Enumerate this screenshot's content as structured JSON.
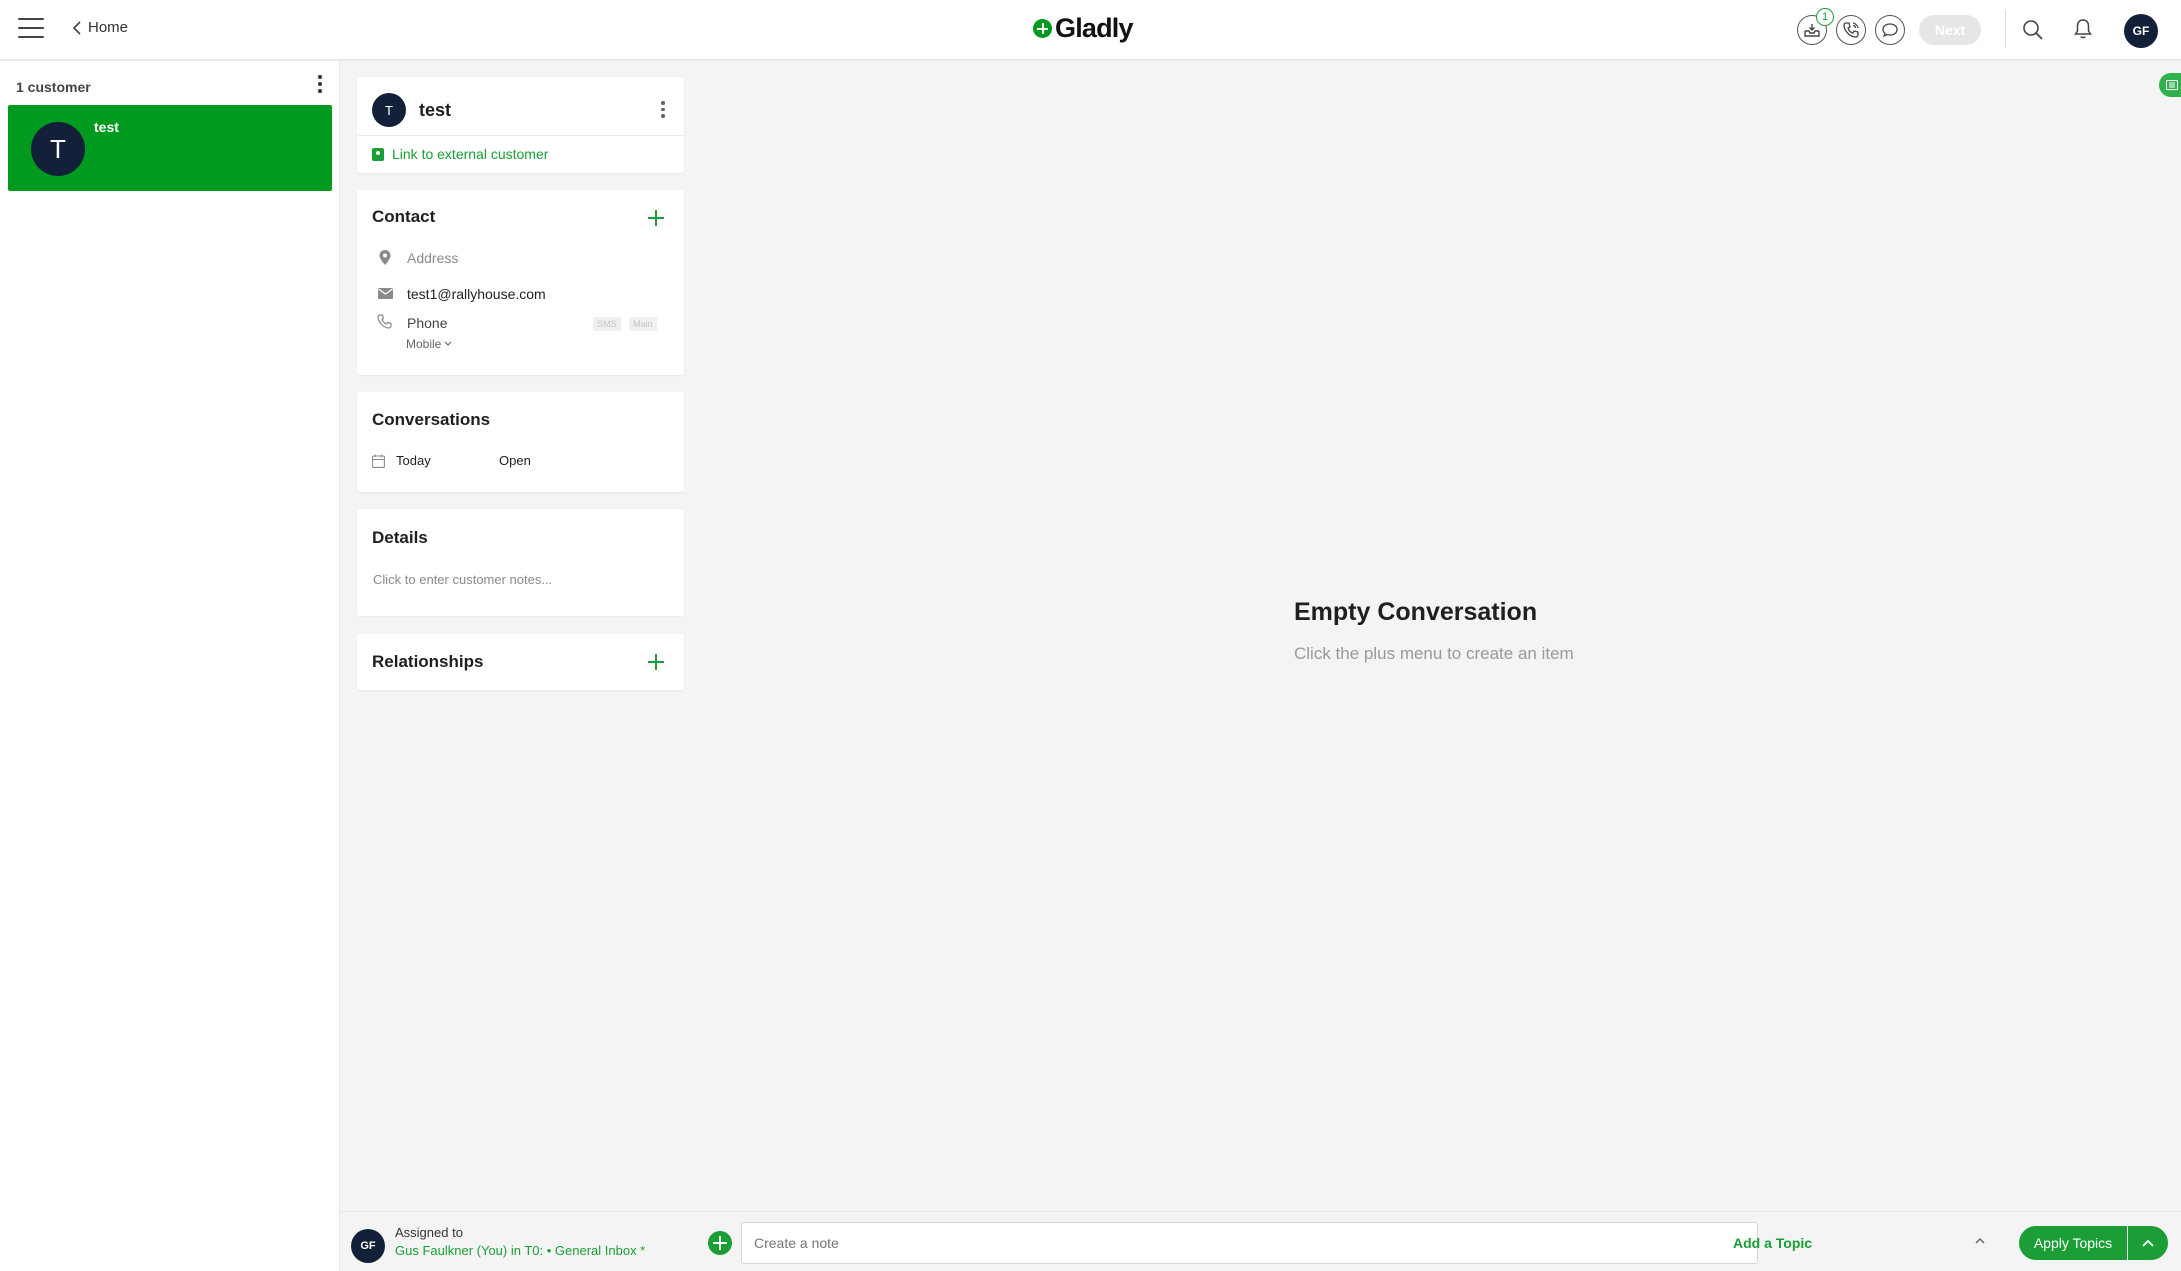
{
  "topbar": {
    "home_label": "Home",
    "logo_text": "Gladly",
    "inbox_badge": "1",
    "next_label": "Next",
    "user_initials": "GF"
  },
  "customers": {
    "count_label": "1 customer",
    "items": [
      {
        "initial": "T",
        "name": "test"
      }
    ]
  },
  "profile": {
    "initial": "T",
    "name": "test",
    "link_external": "Link to external customer"
  },
  "contact": {
    "title": "Contact",
    "address_placeholder": "Address",
    "email": "test1@rallyhouse.com",
    "phone_placeholder": "Phone",
    "phone_type": "Mobile",
    "tags": [
      "SMS",
      "Main"
    ]
  },
  "conversations": {
    "title": "Conversations",
    "items": [
      {
        "date": "Today",
        "status": "Open"
      }
    ]
  },
  "details": {
    "title": "Details",
    "notes_placeholder": "Click to enter customer notes..."
  },
  "relationships": {
    "title": "Relationships"
  },
  "main": {
    "empty_title": "Empty Conversation",
    "empty_subtitle": "Click the plus menu to create an item"
  },
  "bottombar": {
    "assignee_initials": "GF",
    "assigned_label": "Assigned to",
    "assigned_value": "Gus Faulkner (You) in T0: • General Inbox *",
    "note_placeholder": "Create a note",
    "add_topic": "Add a Topic",
    "apply_topics": "Apply Topics"
  },
  "colors": {
    "accent": "#009b1e",
    "link": "#1a9e35",
    "avatar": "#12203a"
  }
}
